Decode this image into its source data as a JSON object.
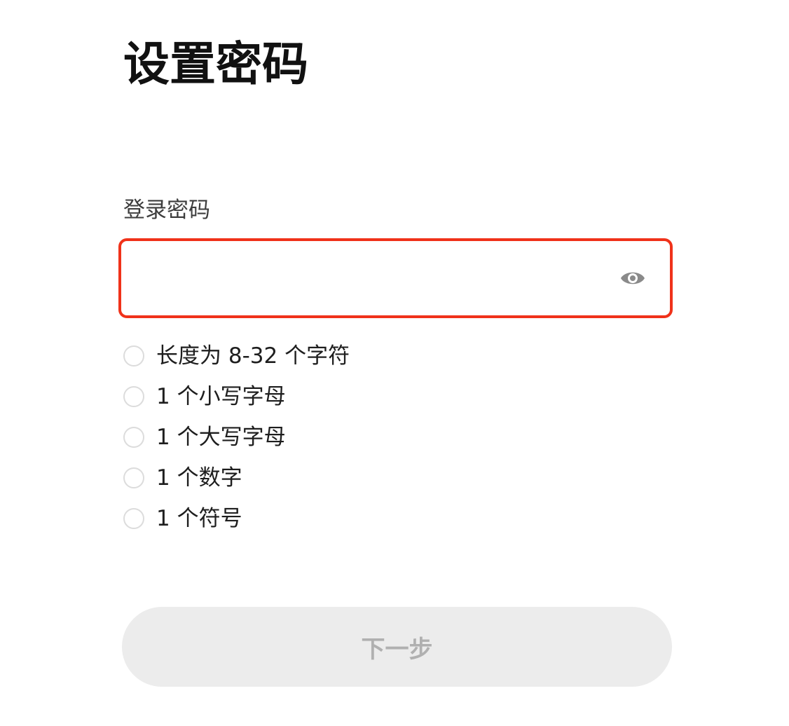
{
  "header": {
    "title": "设置密码"
  },
  "password_field": {
    "label": "登录密码",
    "value": "",
    "placeholder": "",
    "toggle_icon": "eye-icon"
  },
  "requirements": [
    {
      "label": "长度为 8-32 个字符",
      "met": false
    },
    {
      "label": "1 个小写字母",
      "met": false
    },
    {
      "label": "1 个大写字母",
      "met": false
    },
    {
      "label": "1 个数字",
      "met": false
    },
    {
      "label": "1 个符号",
      "met": false
    }
  ],
  "footer": {
    "next_label": "下一步",
    "next_enabled": false
  },
  "colors": {
    "focus_border": "#f0321a",
    "button_bg_disabled": "#ececec",
    "button_text_disabled": "#b0b0b0",
    "check_border": "#dcdcdc",
    "icon_gray": "#8a8a8a"
  }
}
